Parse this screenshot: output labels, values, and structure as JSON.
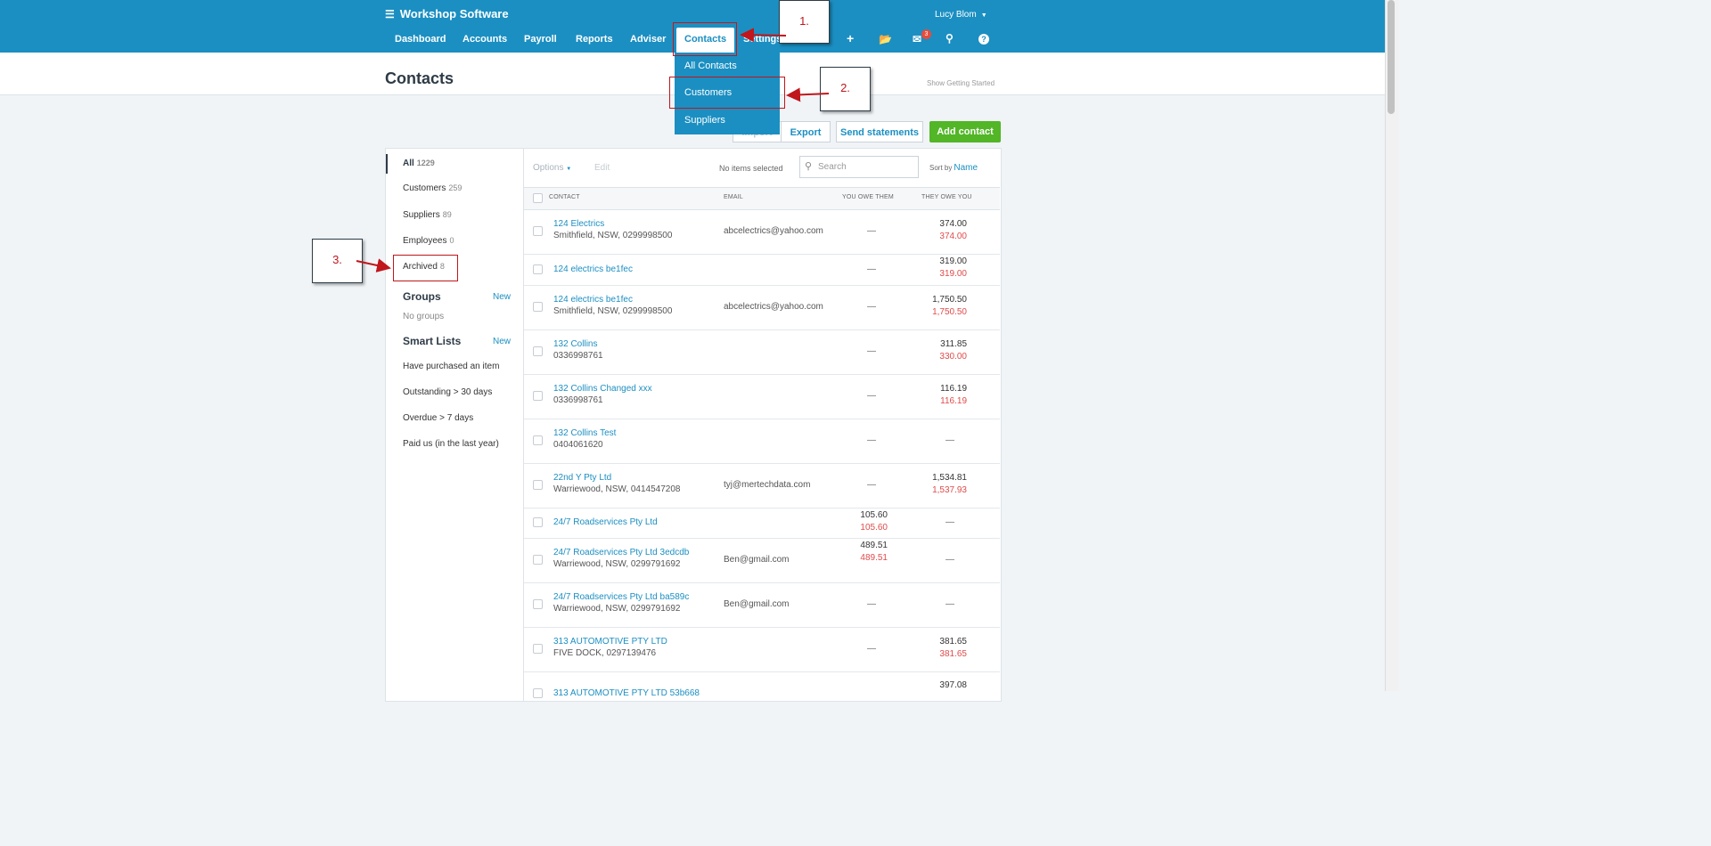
{
  "app": {
    "org_name": "Workshop Software",
    "user_name": "Lucy Blom"
  },
  "nav": {
    "items": [
      "Dashboard",
      "Accounts",
      "Payroll",
      "Reports",
      "Adviser",
      "Contacts",
      "Settings"
    ]
  },
  "toolbar_icons": {
    "mail_badge": "3"
  },
  "page": {
    "title": "Contacts",
    "show_getting_started": "Show Getting Started"
  },
  "dropdown": {
    "items": [
      "All Contacts",
      "Customers",
      "Suppliers"
    ]
  },
  "actions": {
    "import": "Import",
    "export": "Export",
    "send_statements": "Send statements",
    "add_contact": "Add contact"
  },
  "sidebar": {
    "filters": [
      {
        "label": "All",
        "count": "1229"
      },
      {
        "label": "Customers",
        "count": "259"
      },
      {
        "label": "Suppliers",
        "count": "89"
      },
      {
        "label": "Employees",
        "count": "0"
      },
      {
        "label": "Archived",
        "count": "8"
      }
    ],
    "groups_title": "Groups",
    "groups_new": "New",
    "groups_empty": "No groups",
    "smart_lists_title": "Smart Lists",
    "smart_lists_new": "New",
    "smart_lists": [
      "Have purchased an item",
      "Outstanding > 30 days",
      "Overdue > 7 days",
      "Paid us (in the last year)"
    ]
  },
  "list_toolbar": {
    "options": "Options",
    "edit": "Edit",
    "selection": "No items selected",
    "search_placeholder": "Search",
    "sort_label": "Sort by",
    "sort_value": "Name"
  },
  "table": {
    "columns": [
      "CONTACT",
      "EMAIL",
      "YOU OWE THEM",
      "THEY OWE YOU"
    ],
    "rows": [
      {
        "name": "124 Electrics",
        "sub": "Smithfield, NSW, 0299998500",
        "email": "abcelectrics@yahoo.com",
        "owe_them": "—",
        "owe_them_red": "",
        "owe_you": "374.00",
        "owe_you_red": "374.00"
      },
      {
        "name": "124 electrics be1fec",
        "sub": "",
        "email": "",
        "owe_them": "—",
        "owe_them_red": "",
        "owe_you": "319.00",
        "owe_you_red": "319.00"
      },
      {
        "name": "124 electrics be1fec",
        "sub": "Smithfield, NSW, 0299998500",
        "email": "abcelectrics@yahoo.com",
        "owe_them": "—",
        "owe_them_red": "",
        "owe_you": "1,750.50",
        "owe_you_red": "1,750.50"
      },
      {
        "name": "132 Collins",
        "sub": "0336998761",
        "email": "",
        "owe_them": "—",
        "owe_them_red": "",
        "owe_you": "311.85",
        "owe_you_red": "330.00"
      },
      {
        "name": "132 Collins Changed xxx",
        "sub": "0336998761",
        "email": "",
        "owe_them": "—",
        "owe_them_red": "",
        "owe_you": "116.19",
        "owe_you_red": "116.19"
      },
      {
        "name": "132 Collins Test",
        "sub": "0404061620",
        "email": "",
        "owe_them": "—",
        "owe_them_red": "",
        "owe_you": "—",
        "owe_you_red": ""
      },
      {
        "name": "22nd Y Pty Ltd",
        "sub": "Warriewood, NSW, 0414547208",
        "email": "tyj@mertechdata.com",
        "owe_them": "—",
        "owe_them_red": "",
        "owe_you": "1,534.81",
        "owe_you_red": "1,537.93"
      },
      {
        "name": "24/7 Roadservices Pty Ltd",
        "sub": "",
        "email": "",
        "owe_them": "105.60",
        "owe_them_red": "105.60",
        "owe_you": "—",
        "owe_you_red": ""
      },
      {
        "name": "24/7 Roadservices Pty Ltd 3edcdb",
        "sub": "Warriewood, NSW, 0299791692",
        "email": "Ben@gmail.com",
        "owe_them": "489.51",
        "owe_them_red": "489.51",
        "owe_you": "—",
        "owe_you_red": ""
      },
      {
        "name": "24/7 Roadservices Pty Ltd ba589c",
        "sub": "Warriewood, NSW, 0299791692",
        "email": "Ben@gmail.com",
        "owe_them": "—",
        "owe_them_red": "",
        "owe_you": "—",
        "owe_you_red": ""
      },
      {
        "name": "313 AUTOMOTIVE PTY LTD",
        "sub": "FIVE DOCK, 0297139476",
        "email": "",
        "owe_them": "—",
        "owe_them_red": "",
        "owe_you": "381.65",
        "owe_you_red": "381.65"
      },
      {
        "name": "313 AUTOMOTIVE PTY LTD 53b668",
        "sub": "",
        "email": "",
        "owe_them": "",
        "owe_them_red": "",
        "owe_you": "397.08",
        "owe_you_red": ""
      }
    ]
  },
  "annotations": {
    "step1": "1.",
    "step2": "2.",
    "step3": "3."
  },
  "colors": {
    "brand": "#1b8fc2",
    "add_button": "#52b627",
    "negative": "#e04b4b",
    "annotation": "#c0161c"
  }
}
